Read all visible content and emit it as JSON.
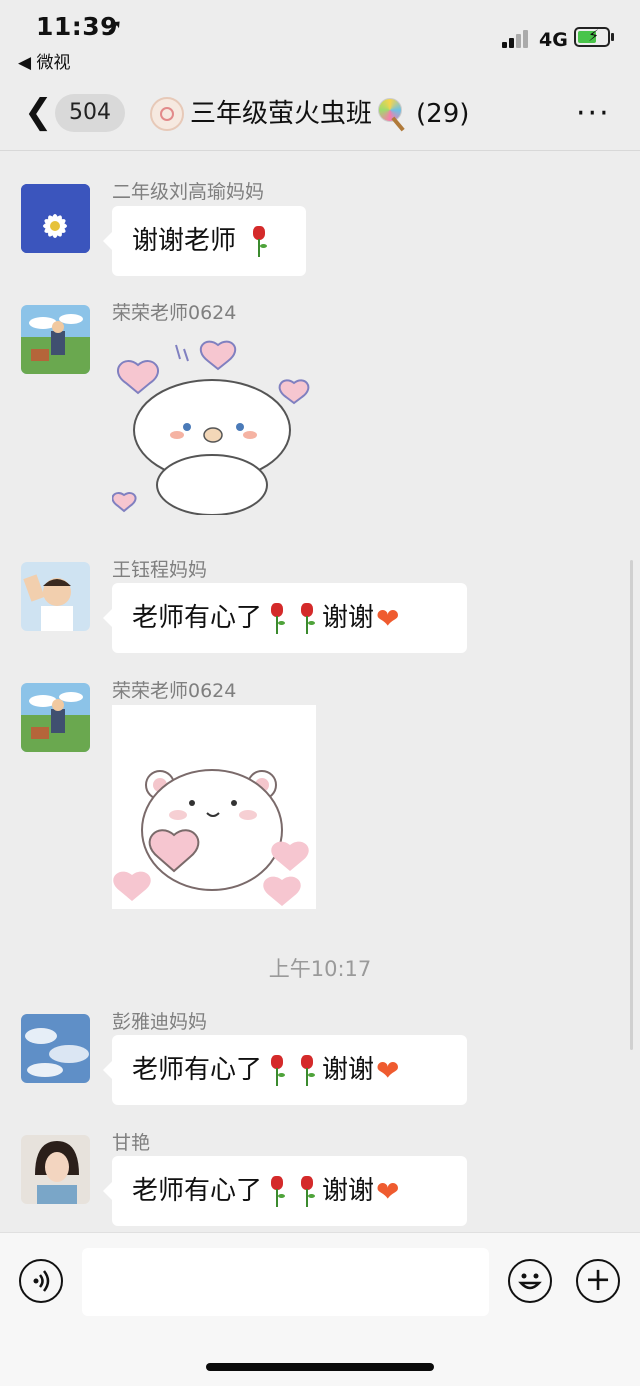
{
  "status_bar": {
    "time": "11:39",
    "location_glyph": "➚",
    "back_app": "◀ 微视",
    "network": "4G"
  },
  "nav": {
    "back_icon": "chevron-left",
    "unread_count": "504",
    "title_main": "三年级萤火虫班",
    "title_count": "(29)",
    "more_icon": "···"
  },
  "messages": [
    {
      "sender": "二年级刘高瑜妈妈",
      "text": "谢谢老师"
    },
    {
      "sender": "荣荣老师0624",
      "sticker": "puppy-hearts-sticker"
    },
    {
      "sender": "王钰程妈妈",
      "text_a": "老师有心了",
      "text_b": "谢谢"
    },
    {
      "sender": "荣荣老师0624",
      "sticker": "bear-heart-sticker"
    },
    {
      "sender": "彭雅迪妈妈",
      "text_a": "老师有心了",
      "text_b": "谢谢"
    },
    {
      "sender": "甘艳",
      "text_a": "老师有心了",
      "text_b": "谢谢"
    }
  ],
  "time_separator": "上午10:17",
  "input": {
    "placeholder": "",
    "voice_icon": "voice-icon",
    "emoji_icon": "emoji-icon",
    "plus_icon": "plus-icon"
  },
  "colors": {
    "background": "#ededed",
    "bubble": "#ffffff",
    "sender": "#7f7f7f",
    "battery": "#49c44a",
    "heart": "#ef5b2f"
  }
}
